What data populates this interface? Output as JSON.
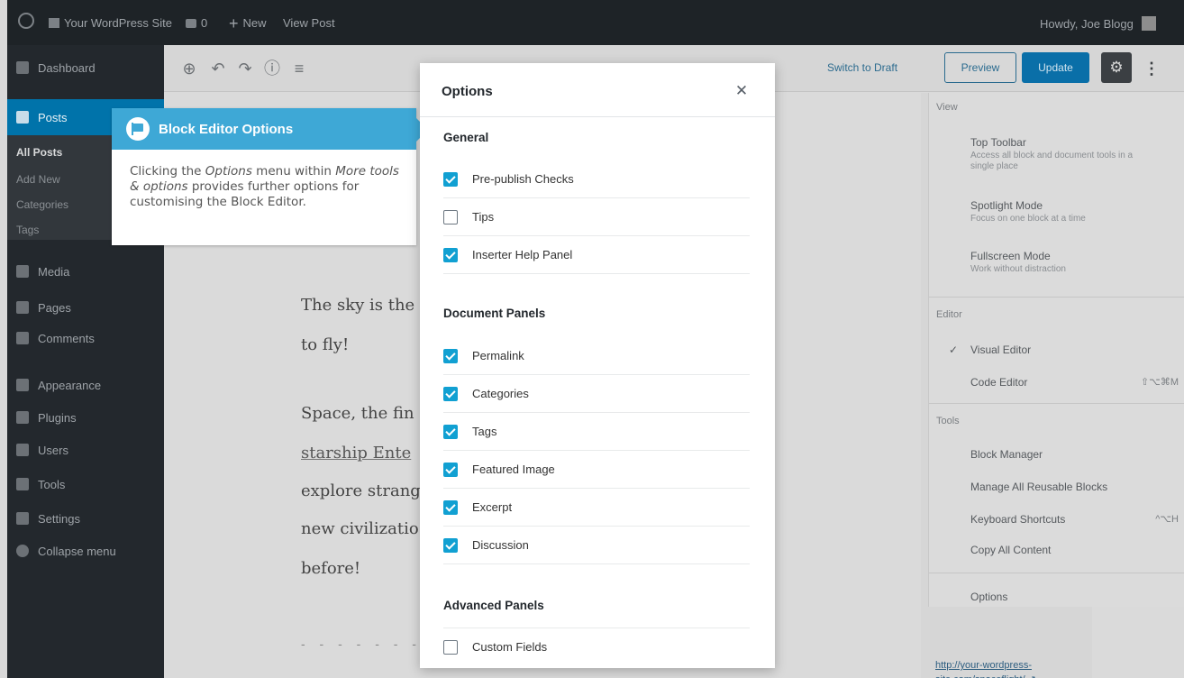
{
  "admin_bar": {
    "site_name": "Your WordPress Site",
    "comments_count": "0",
    "new_label": "New",
    "view_post_label": "View Post",
    "greeting": "Howdy, Joe Blogg"
  },
  "sidebar": {
    "items": [
      {
        "label": "Dashboard"
      },
      {
        "label": "Posts"
      },
      {
        "label": "Media"
      },
      {
        "label": "Pages"
      },
      {
        "label": "Comments"
      },
      {
        "label": "Appearance"
      },
      {
        "label": "Plugins"
      },
      {
        "label": "Users"
      },
      {
        "label": "Tools"
      },
      {
        "label": "Settings"
      },
      {
        "label": "Collapse menu"
      }
    ],
    "posts_submenu": [
      "All Posts",
      "Add New",
      "Categories",
      "Tags"
    ]
  },
  "toolbar": {
    "switch_to_draft": "Switch to Draft",
    "preview": "Preview",
    "update": "Update"
  },
  "post": {
    "lines": [
      "The sky is the",
      "to fly!",
      "Space, the fin",
      "starship Ente",
      "explore strang",
      "new civilizatio",
      "before!"
    ]
  },
  "more_menu": {
    "view_title": "View",
    "top_toolbar": "Top Toolbar",
    "top_toolbar_desc": "Access all block and document tools in a single place",
    "spotlight": "Spotlight Mode",
    "spotlight_desc": "Focus on one block at a time",
    "fullscreen": "Fullscreen Mode",
    "fullscreen_desc": "Work without distraction",
    "editor_title": "Editor",
    "visual_editor": "Visual Editor",
    "code_editor": "Code Editor",
    "code_editor_shortcut": "⇧⌥⌘M",
    "tools_title": "Tools",
    "block_manager": "Block Manager",
    "manage_reusable": "Manage All Reusable Blocks",
    "keyboard_shortcuts": "Keyboard Shortcuts",
    "keyboard_shortcuts_key": "^⌥H",
    "copy_all": "Copy All Content",
    "options": "Options",
    "permalink_text": "http://your-wordpress-site.com/spaceflight/"
  },
  "callout": {
    "title": "Block Editor Options",
    "body_1": "Clicking the ",
    "body_em1": "Options",
    "body_2": " menu within ",
    "body_em2": "More tools & options",
    "body_3": " provides further options for customising the Block Editor."
  },
  "modal": {
    "title": "Options",
    "sections": [
      {
        "title": "General",
        "options": [
          {
            "label": "Pre-publish Checks",
            "checked": true
          },
          {
            "label": "Tips",
            "checked": false
          },
          {
            "label": "Inserter Help Panel",
            "checked": true
          }
        ]
      },
      {
        "title": "Document Panels",
        "options": [
          {
            "label": "Permalink",
            "checked": true
          },
          {
            "label": "Categories",
            "checked": true
          },
          {
            "label": "Tags",
            "checked": true
          },
          {
            "label": "Featured Image",
            "checked": true
          },
          {
            "label": "Excerpt",
            "checked": true
          },
          {
            "label": "Discussion",
            "checked": true
          }
        ]
      },
      {
        "title": "Advanced Panels",
        "options": [
          {
            "label": "Custom Fields",
            "checked": false
          }
        ]
      }
    ]
  },
  "colors": {
    "accent": "#3ea8d6",
    "checkbox": "#11a0d2",
    "admin_bar": "#1e2327",
    "sidebar": "#23282d",
    "active_menu": "#0073aa"
  }
}
